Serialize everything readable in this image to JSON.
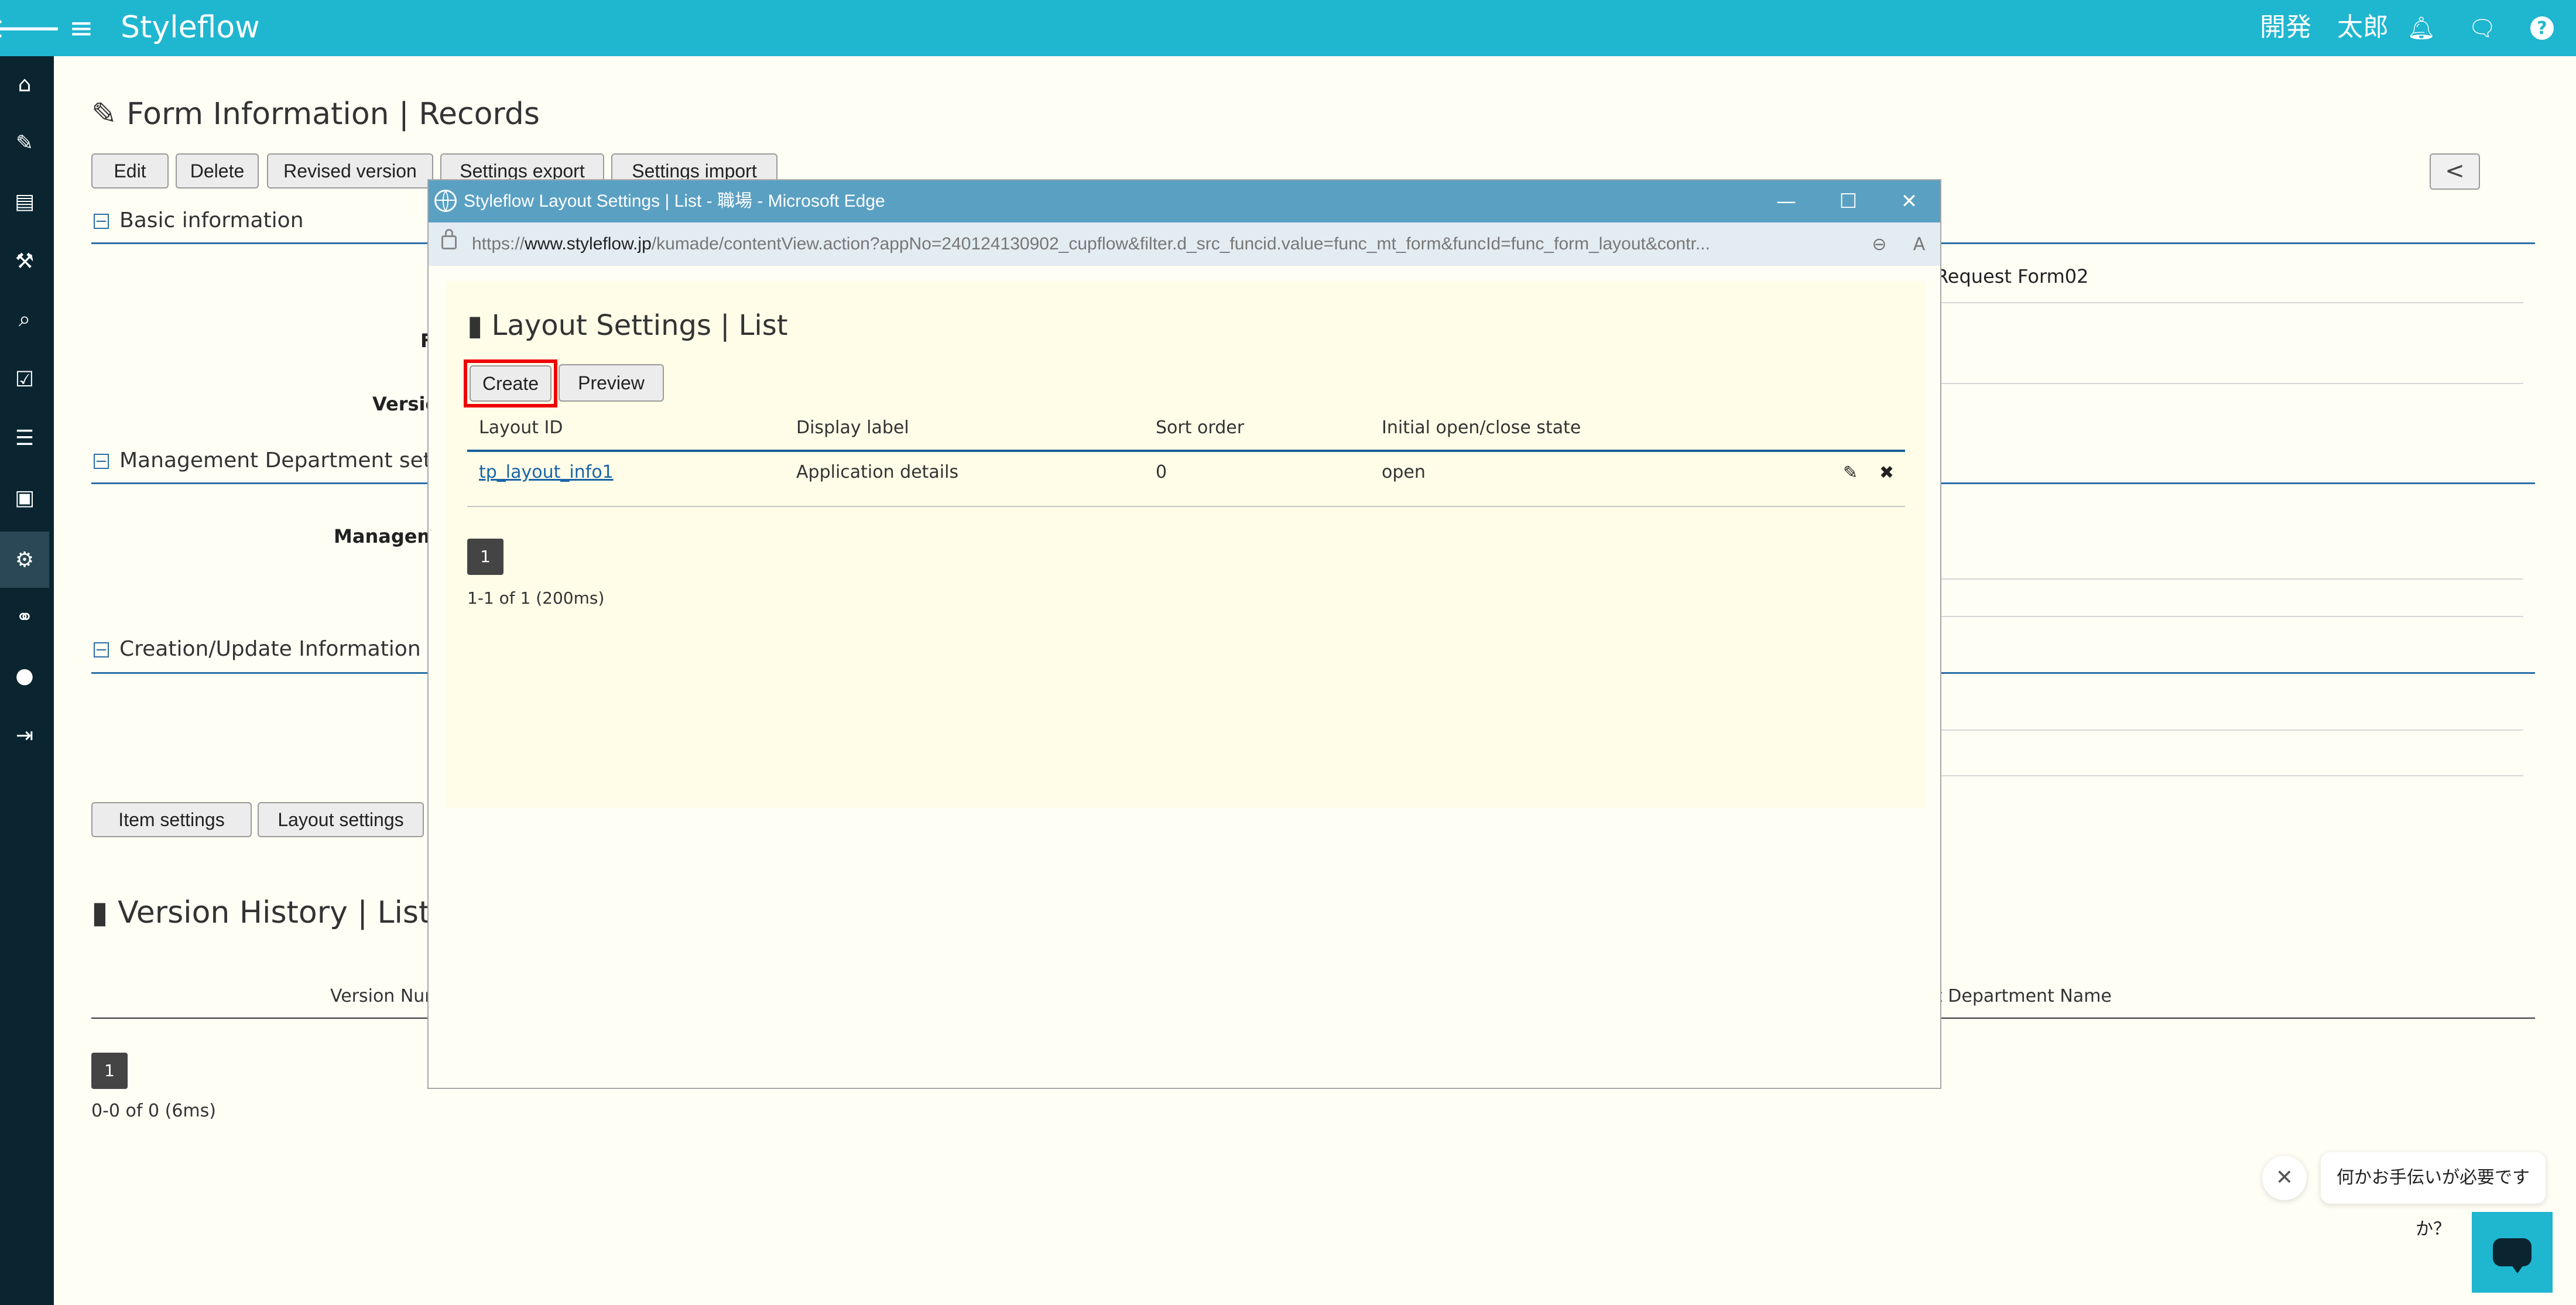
{
  "header": {
    "back_icon": "arrow-left-icon",
    "menu_icon": "hamburger-icon",
    "brand": "Styleflow",
    "user_name": "開発　太郎",
    "icons": [
      "bell-icon",
      "chat-icon",
      "help-icon"
    ],
    "accent_color": "#1fb6d0"
  },
  "sidebar": {
    "bg_color": "#0a2530",
    "items": [
      {
        "icon": "home-icon",
        "glyph": "⌂"
      },
      {
        "icon": "edit-icon",
        "glyph": "✎"
      },
      {
        "icon": "book-icon",
        "glyph": "▤"
      },
      {
        "icon": "hammer-icon",
        "glyph": "⚒"
      },
      {
        "icon": "search-icon",
        "glyph": "⌕"
      },
      {
        "icon": "check-square-icon",
        "glyph": "☑"
      },
      {
        "icon": "server-icon",
        "glyph": "☰"
      },
      {
        "icon": "id-card-icon",
        "glyph": "▣"
      },
      {
        "icon": "settings-icon",
        "glyph": "⚙"
      },
      {
        "icon": "link-icon",
        "glyph": "⚭"
      },
      {
        "icon": "user-icon",
        "glyph": "●"
      },
      {
        "icon": "sign-out-icon",
        "glyph": "⇥"
      }
    ]
  },
  "main": {
    "title": "Form Information | Records",
    "toolbar": {
      "edit": "Edit",
      "delete": "Delete",
      "revised_version": "Revised version",
      "settings_export": "Settings export",
      "settings_import": "Settings import",
      "collapse": "<"
    },
    "sections": {
      "basic": "Basic information",
      "management": "Management Department setting",
      "creation": "Creation/Update Information"
    },
    "fragments": {
      "f": "F",
      "version": "Version",
      "management": "Manageme",
      "request_form": "Request Form02"
    },
    "bottom_buttons": {
      "item_settings": "Item settings",
      "layout_settings": "Layout settings"
    },
    "history": {
      "title": "Version History | List",
      "col_version": "Version Num",
      "col_department": "t Department Name",
      "page": "1",
      "status": "0-0 of 0 (6ms)"
    }
  },
  "popup": {
    "window_title": "Styleflow Layout Settings | List - 職場 - Microsoft Edge",
    "url_prefix": "https://",
    "url_domain": "www.styleflow.jp",
    "url_rest": "/kumade/contentView.action?appNo=240124130902_cupflow&filter.d_src_funcid.value=func_mt_form&funcId=func_form_layout&contr...",
    "controls": {
      "minimize": "—",
      "maximize": "☐",
      "close": "✕"
    },
    "title": "Layout Settings | List",
    "buttons": {
      "create": "Create",
      "preview": "Preview"
    },
    "table": {
      "headers": [
        "Layout ID",
        "Display label",
        "Sort order",
        "Initial open/close state"
      ],
      "rows": [
        {
          "layout_id": "tp_layout_info1",
          "display_label": "Application details",
          "sort_order": "0",
          "state": "open"
        }
      ]
    },
    "page": "1",
    "status": "1-1 of 1 (200ms)"
  },
  "chat": {
    "message": "何かお手伝いが必要ですか？",
    "close": "✕"
  }
}
